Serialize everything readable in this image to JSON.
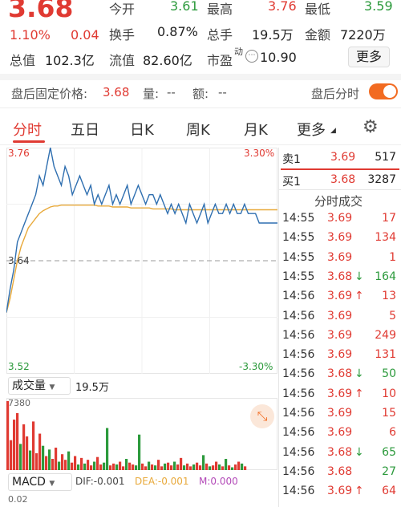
{
  "header": {
    "price": "3.68",
    "change_pct": "1.10%",
    "change_abs": "0.04",
    "open_label": "今开",
    "open": "3.61",
    "high_label": "最高",
    "high": "3.76",
    "low_label": "最低",
    "low": "3.59",
    "turnover_label": "换手",
    "turnover": "0.87%",
    "volume_label": "总手",
    "volume": "19.5万",
    "amount_label": "金额",
    "amount": "7220万",
    "mktcap_label": "总值",
    "mktcap": "102.3亿",
    "float_label": "流值",
    "float": "82.60亿",
    "pe_label": "市盈",
    "pe_super": "动",
    "pe": "10.90",
    "more_label": "更多"
  },
  "after_hours": {
    "price_label": "盘后固定价格:",
    "price": "3.68",
    "volume_label": "量:",
    "volume": "--",
    "amount_label": "额:",
    "amount": "--",
    "timeshare_label": "盘后分时"
  },
  "tabs": [
    {
      "label": "分时",
      "active": true
    },
    {
      "label": "五日"
    },
    {
      "label": "日K"
    },
    {
      "label": "周K"
    },
    {
      "label": "月K"
    },
    {
      "label": "更多"
    }
  ],
  "chart": {
    "top_price": "3.76",
    "top_pct": "3.30%",
    "mid_price": "3.64",
    "bottom_price": "3.52",
    "bottom_pct": "-3.30%",
    "volume_selector": "成交量",
    "volume_total": "19.5万",
    "volume_max": "7380",
    "macd_selector": "MACD",
    "dif": "DIF:-0.001",
    "dea": "DEA:-0.001",
    "m": "M:0.000",
    "macd_axis": "0.02"
  },
  "order_book": {
    "sell": {
      "label": "卖1",
      "price": "3.69",
      "volume": "517"
    },
    "buy": {
      "label": "买1",
      "price": "3.68",
      "volume": "3287"
    }
  },
  "ticks_title": "分时成交",
  "ticks": [
    {
      "time": "14:55",
      "price": "3.69",
      "dir": "",
      "vol": "17",
      "color": "red"
    },
    {
      "time": "14:55",
      "price": "3.69",
      "dir": "",
      "vol": "134",
      "color": "red"
    },
    {
      "time": "14:55",
      "price": "3.69",
      "dir": "",
      "vol": "1",
      "color": "red"
    },
    {
      "time": "14:55",
      "price": "3.68",
      "dir": "↓",
      "vol": "164",
      "color": "green"
    },
    {
      "time": "14:56",
      "price": "3.69",
      "dir": "↑",
      "vol": "13",
      "color": "red"
    },
    {
      "time": "14:56",
      "price": "3.69",
      "dir": "",
      "vol": "5",
      "color": "red"
    },
    {
      "time": "14:56",
      "price": "3.69",
      "dir": "",
      "vol": "249",
      "color": "red"
    },
    {
      "time": "14:56",
      "price": "3.69",
      "dir": "",
      "vol": "131",
      "color": "red"
    },
    {
      "time": "14:56",
      "price": "3.68",
      "dir": "↓",
      "vol": "50",
      "color": "green"
    },
    {
      "time": "14:56",
      "price": "3.69",
      "dir": "↑",
      "vol": "10",
      "color": "red"
    },
    {
      "time": "14:56",
      "price": "3.69",
      "dir": "",
      "vol": "15",
      "color": "red"
    },
    {
      "time": "14:56",
      "price": "3.69",
      "dir": "",
      "vol": "6",
      "color": "red"
    },
    {
      "time": "14:56",
      "price": "3.68",
      "dir": "↓",
      "vol": "65",
      "color": "green"
    },
    {
      "time": "14:56",
      "price": "3.68",
      "dir": "",
      "vol": "27",
      "color": "green"
    },
    {
      "time": "14:56",
      "price": "3.69",
      "dir": "↑",
      "vol": "64",
      "color": "red"
    }
  ],
  "colors": {
    "up": "#e03a32",
    "down": "#2c9a3c",
    "price_line": "#2f6fb0",
    "avg_line": "#e8a93a",
    "accent": "#f26b21"
  },
  "chart_data": {
    "type": "line",
    "ylim": [
      3.52,
      3.76
    ],
    "prev_close": 3.64,
    "series": [
      {
        "values": [
          3.585,
          3.61,
          3.63,
          3.66,
          3.67,
          3.68,
          3.69,
          3.7,
          3.71,
          3.73,
          3.72,
          3.74,
          3.76,
          3.74,
          3.73,
          3.72,
          3.74,
          3.73,
          3.71,
          3.72,
          3.73,
          3.72,
          3.71,
          3.72,
          3.7,
          3.71,
          3.7,
          3.71,
          3.72,
          3.7,
          3.71,
          3.7,
          3.71,
          3.72,
          3.7,
          3.71,
          3.72,
          3.71,
          3.7,
          3.71,
          3.71,
          3.7,
          3.71,
          3.7,
          3.69,
          3.7,
          3.69,
          3.7,
          3.69,
          3.68,
          3.7,
          3.69,
          3.68,
          3.69,
          3.7,
          3.68,
          3.69,
          3.7,
          3.69,
          3.69,
          3.7,
          3.69,
          3.7,
          3.69,
          3.69,
          3.7,
          3.69,
          3.69,
          3.69,
          3.68,
          3.68,
          3.68,
          3.68,
          3.68,
          3.68
        ]
      },
      {
        "values": [
          3.585,
          3.6,
          3.62,
          3.64,
          3.655,
          3.665,
          3.675,
          3.68,
          3.685,
          3.69,
          3.693,
          3.695,
          3.697,
          3.698,
          3.698,
          3.699,
          3.699,
          3.699,
          3.699,
          3.699,
          3.699,
          3.699,
          3.699,
          3.699,
          3.699,
          3.698,
          3.698,
          3.698,
          3.698,
          3.697,
          3.697,
          3.697,
          3.697,
          3.697,
          3.696,
          3.696,
          3.696,
          3.696,
          3.696,
          3.696,
          3.695,
          3.695,
          3.695,
          3.695,
          3.695,
          3.695,
          3.694,
          3.694,
          3.694,
          3.694,
          3.694,
          3.694,
          3.694,
          3.694,
          3.694,
          3.694,
          3.694,
          3.694,
          3.694,
          3.694,
          3.694,
          3.694,
          3.694,
          3.694,
          3.694,
          3.694,
          3.694,
          3.694,
          3.694,
          3.694,
          3.694,
          3.694,
          3.694,
          3.694,
          3.694
        ]
      }
    ],
    "volume": [
      7380,
      3200,
      5400,
      6100,
      2800,
      4900,
      3600,
      2100,
      5200,
      1800,
      3900,
      2600,
      1500,
      2200,
      1200,
      2400,
      900,
      1700,
      1100,
      2000,
      800,
      1500,
      600,
      1300,
      700,
      1100,
      500,
      900,
      1400,
      600,
      800,
      4500,
      500,
      700,
      600,
      900,
      400,
      1200,
      800,
      600,
      500,
      3800,
      700,
      400,
      900,
      600,
      500,
      1100,
      400,
      700,
      800,
      500,
      900,
      600,
      1300,
      500,
      700,
      400,
      600,
      800,
      500,
      1600,
      700,
      400,
      500,
      900,
      600,
      400,
      1200,
      500,
      300,
      600,
      900,
      700,
      400
    ],
    "volume_colors": [
      "r",
      "r",
      "r",
      "r",
      "g",
      "r",
      "r",
      "g",
      "r",
      "r",
      "r",
      "g",
      "r",
      "g",
      "r",
      "r",
      "g",
      "r",
      "r",
      "g",
      "r",
      "r",
      "g",
      "r",
      "g",
      "r",
      "r",
      "g",
      "r",
      "r",
      "g",
      "g",
      "r",
      "r",
      "g",
      "r",
      "r",
      "g",
      "r",
      "r",
      "g",
      "g",
      "r",
      "r",
      "g",
      "r",
      "g",
      "r",
      "r",
      "g",
      "r",
      "r",
      "g",
      "r",
      "r",
      "g",
      "r",
      "r",
      "g",
      "r",
      "r",
      "g",
      "r",
      "g",
      "r",
      "r",
      "g",
      "r",
      "g",
      "r",
      "g",
      "r",
      "r",
      "g",
      "r"
    ]
  }
}
